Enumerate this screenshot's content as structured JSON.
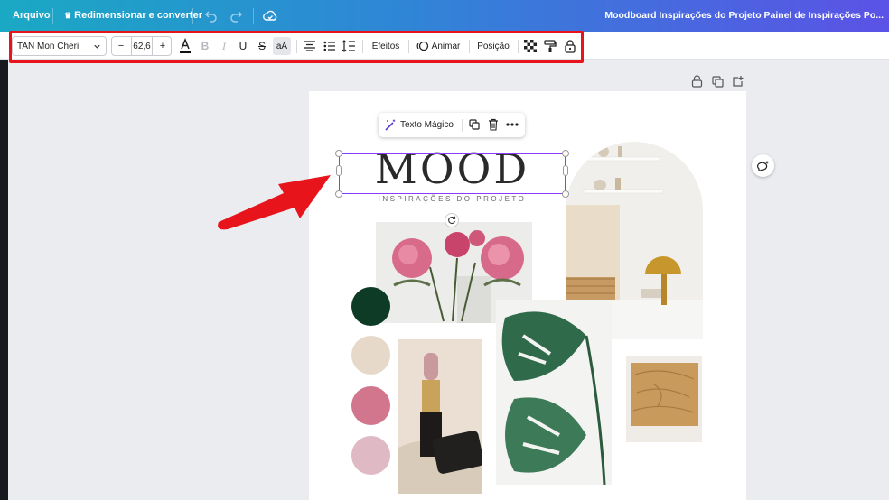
{
  "topbar": {
    "file_label": "Arquivo",
    "resize_label": "Redimensionar e converter",
    "doc_title": "Moodboard Inspirações do Projeto Painel de Inspirações Po..."
  },
  "toolbar": {
    "font_name": "TAN Mon Cheri",
    "font_size": "62,6",
    "minus": "−",
    "plus": "+",
    "case_label": "aA",
    "effects_label": "Efeitos",
    "animate_label": "Animar",
    "position_label": "Posição"
  },
  "floating_toolbar": {
    "magic_text_label": "Texto Mágico"
  },
  "canvas": {
    "title": "MOOD",
    "subtitle": "INSPIRAÇÕES DO PROJETO"
  },
  "palette": {
    "colors": [
      "#0e3b26",
      "#e7d9ca",
      "#d1768c",
      "#dfb9c4"
    ]
  },
  "accent_color": "#8b3dff",
  "annotation_color": "#e8141b"
}
